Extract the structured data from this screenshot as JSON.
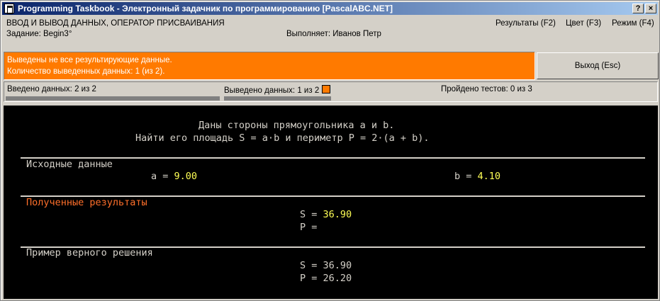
{
  "window": {
    "title": "Programming Taskbook - Электронный задачник по программированию [PascalABC.NET]",
    "help_btn": "?",
    "close_btn": "×"
  },
  "header": {
    "topic": "ВВОД И ВЫВОД ДАННЫХ, ОПЕРАТОР ПРИСВАИВАНИЯ",
    "task": "Задание: Begin3°",
    "performer": "Выполняет: Иванов Петр",
    "menu": [
      "Результаты (F2)",
      "Цвет (F3)",
      "Режим (F4)"
    ]
  },
  "message": {
    "line1": "Выведены не все результирующие данные.",
    "line2": "Количество выведенных данных: 1 (из 2).",
    "color": "#ff7a00"
  },
  "exit_button": "Выход (Esc)",
  "status": {
    "entered_label": "Введено данных:",
    "entered_value": "2 из 2",
    "entered_progress": 1.0,
    "output_label": "Выведено данных:",
    "output_value": "1 из 2",
    "output_progress": 0.5,
    "tests_label": "Пройдено тестов:",
    "tests_value": "0 из 3"
  },
  "console": {
    "problem_line1": "Даны стороны прямоугольника a и b.",
    "problem_line2": "Найти его площадь S = a·b и периметр P = 2·(a + b).",
    "input_title": "Исходные данные",
    "a_label": "a = ",
    "a_value": "9.00",
    "b_label": "b = ",
    "b_value": "4.10",
    "results_title": "Полученные результаты",
    "res_s_label": "S = ",
    "res_s_value": "36.90",
    "res_p_label": "P = ",
    "res_p_value": "",
    "example_title": "Пример верного решения",
    "ex_s": "S = 36.90",
    "ex_p": "P = 26.20"
  }
}
